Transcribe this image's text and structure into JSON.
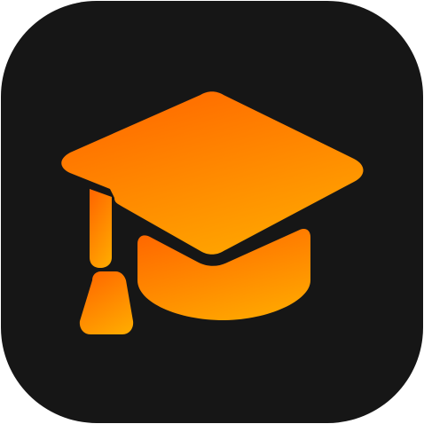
{
  "icon": {
    "name": "graduation-cap-icon",
    "background_color": "#161616",
    "gradient_start": "#FF6A00",
    "gradient_end": "#FFA800"
  }
}
